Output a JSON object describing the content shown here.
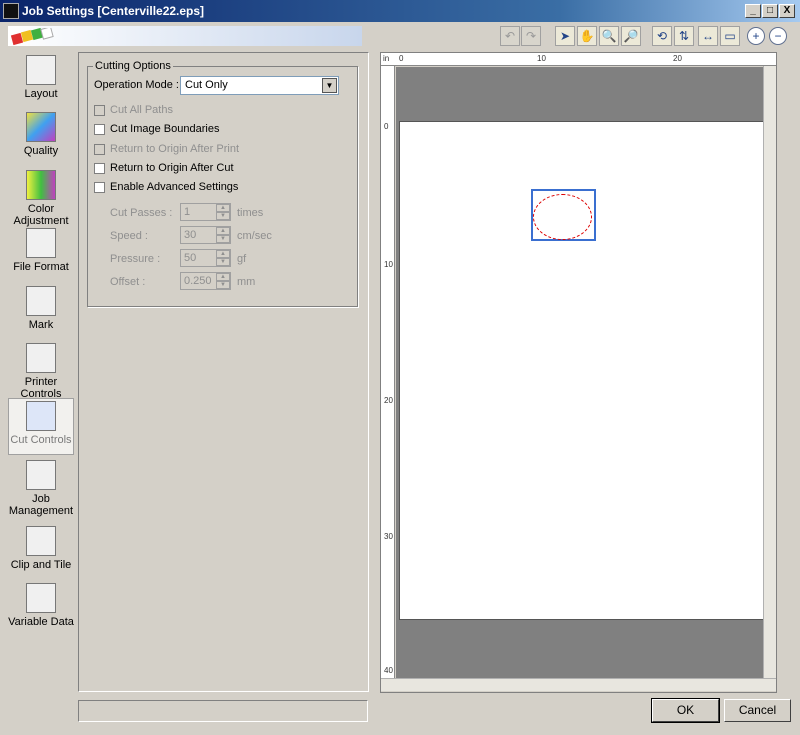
{
  "window": {
    "title": "Job Settings [Centerville22.eps]",
    "minimize": "_",
    "maximize": "□",
    "close": "X"
  },
  "sidebar": {
    "items": [
      {
        "label": "Layout"
      },
      {
        "label": "Quality"
      },
      {
        "label": "Color Adjustment"
      },
      {
        "label": "File Format"
      },
      {
        "label": "Mark"
      },
      {
        "label": "Printer Controls"
      },
      {
        "label": "Cut Controls"
      },
      {
        "label": "Job Management"
      },
      {
        "label": "Clip and Tile"
      },
      {
        "label": "Variable Data"
      }
    ]
  },
  "cutting": {
    "group_title": "Cutting Options",
    "operation_mode_label": "Operation Mode :",
    "operation_mode_value": "Cut Only",
    "checkboxes": [
      {
        "label": "Cut All Paths"
      },
      {
        "label": "Cut Image Boundaries"
      },
      {
        "label": "Return to Origin After Print"
      },
      {
        "label": "Return to Origin After Cut"
      },
      {
        "label": "Enable Advanced Settings"
      }
    ],
    "fields": [
      {
        "label": "Cut Passes :",
        "value": "1",
        "unit": "times"
      },
      {
        "label": "Speed :",
        "value": "30",
        "unit": "cm/sec"
      },
      {
        "label": "Pressure :",
        "value": "50",
        "unit": "gf"
      },
      {
        "label": "Offset :",
        "value": "0.250",
        "unit": "mm"
      }
    ]
  },
  "buttons": {
    "ok": "OK",
    "cancel": "Cancel"
  },
  "ruler": {
    "unit": "in",
    "top_ticks": [
      "0",
      "10",
      "20"
    ],
    "left_ticks": [
      "0",
      "10",
      "20",
      "30",
      "40"
    ]
  }
}
